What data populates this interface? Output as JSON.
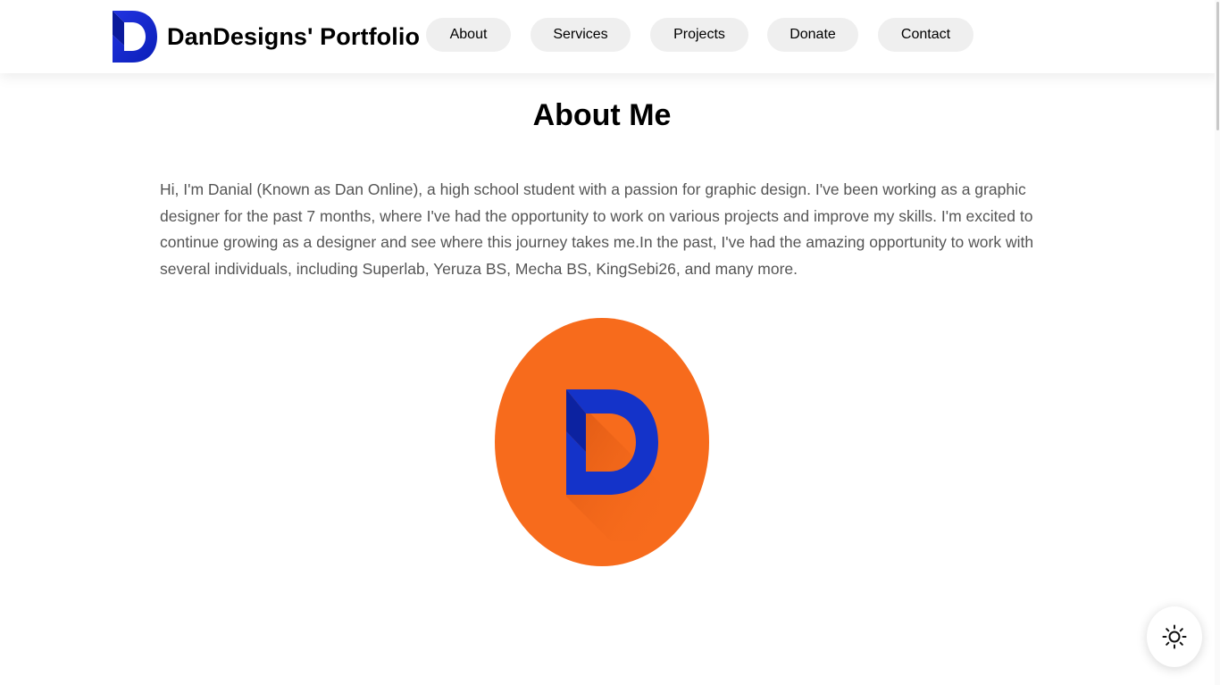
{
  "header": {
    "title": "DanDesigns' Portfolio",
    "logo_icon": "d-letter-logo-icon",
    "logo_colors": [
      "#1d33d6",
      "#0a1fb8"
    ],
    "nav": [
      {
        "label": "About"
      },
      {
        "label": "Services"
      },
      {
        "label": "Projects"
      },
      {
        "label": "Donate"
      },
      {
        "label": "Contact"
      }
    ]
  },
  "main": {
    "heading": "About Me",
    "intro": "Hi, I'm Danial (Known as Dan Online), a high school student with a passion for graphic design. I've been working as a graphic designer for the past 7 months, where I've had the opportunity to work on various projects and improve my skills. I'm excited to continue growing as a designer and see where this journey takes me.In the past, I've had the amazing opportunity to work with several individuals, including Superlab, Yeruza BS, Mecha BS, KingSebi26, and many more.",
    "portrait_colors": {
      "background": "#f76b1c",
      "letter": "#1433c9"
    }
  },
  "theme_toggle": {
    "icon": "sun-icon"
  }
}
